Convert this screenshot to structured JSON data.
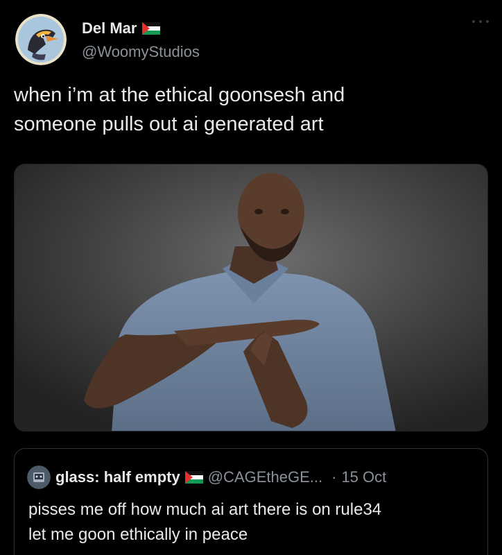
{
  "post": {
    "author": {
      "display_name": "Del Mar",
      "handle": "@WoomyStudios",
      "flag_icon": "palestine-flag-icon",
      "avatar_icon": "cartoon-bird-avatar"
    },
    "text_line1": "when i’m at the ethical goonsesh and",
    "text_line2": "someone pulls out ai generated art",
    "media": {
      "description_icon": "man-making-timeout-gesture-photo"
    }
  },
  "quote": {
    "display_name": "glass: half empty",
    "handle": "@CAGEtheGE...",
    "separator": "·",
    "date": "15 Oct",
    "text_line1": "pisses me off how much ai art there is on rule34",
    "text_line2": "let me goon ethically in peace",
    "flag_icon": "palestine-flag-icon"
  },
  "colors": {
    "background": "#000000",
    "text": "#e7e9ea",
    "secondary": "#8b9198",
    "border": "#2f3336"
  }
}
